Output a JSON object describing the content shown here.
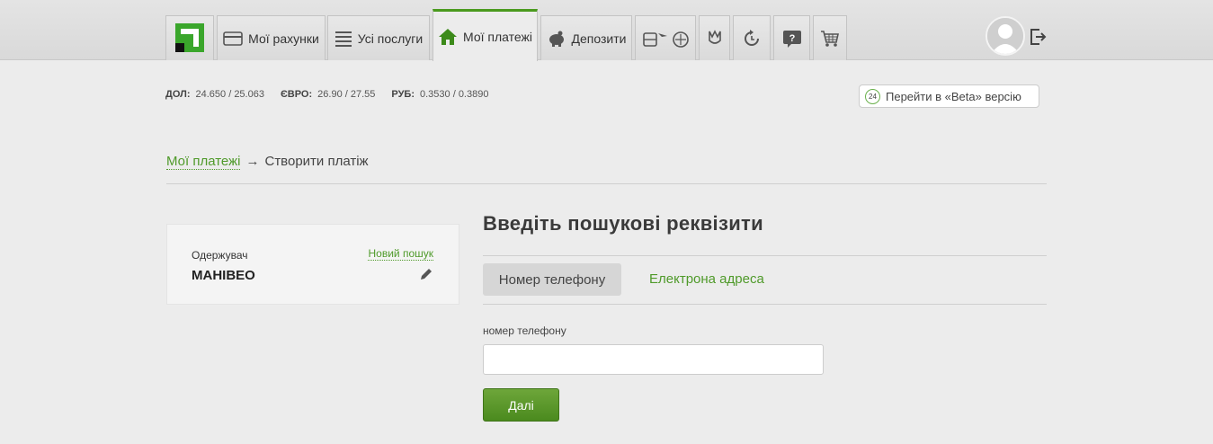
{
  "nav": {
    "tabs": [
      {
        "label": "Мої рахунки",
        "icon": "card-icon"
      },
      {
        "label": "Усі послуги",
        "icon": "list-icon"
      },
      {
        "label": "Мої платежі",
        "icon": "home-icon",
        "active": true
      },
      {
        "label": "Депозити",
        "icon": "piggy-bank-icon"
      }
    ],
    "icon_tabs": [
      "travel-icon",
      "trident-icon",
      "refresh-icon",
      "help-icon",
      "cart-icon"
    ]
  },
  "rates": [
    {
      "label": "ДОЛ:",
      "value": "24.650 / 25.063"
    },
    {
      "label": "ЄВРО:",
      "value": "26.90 / 27.55"
    },
    {
      "label": "РУБ:",
      "value": "0.3530 / 0.3890"
    }
  ],
  "beta": {
    "badge": "24",
    "label": "Перейти в «Beta» версію"
  },
  "breadcrumb": {
    "link": "Мої платежі",
    "arrow": "→",
    "current": "Створити платіж"
  },
  "recipient": {
    "label": "Одержувач",
    "name": "МАНІВЕО",
    "new_search": "Новий пошук"
  },
  "form": {
    "heading": "Введіть пошукові реквізити",
    "tab_active": "Номер телефону",
    "tab_other": "Електрона адреса",
    "field_label": "номер телефону",
    "field_value": "",
    "submit": "Далі"
  },
  "colors": {
    "accent": "#4f9a2a",
    "button": "#5a9628"
  }
}
